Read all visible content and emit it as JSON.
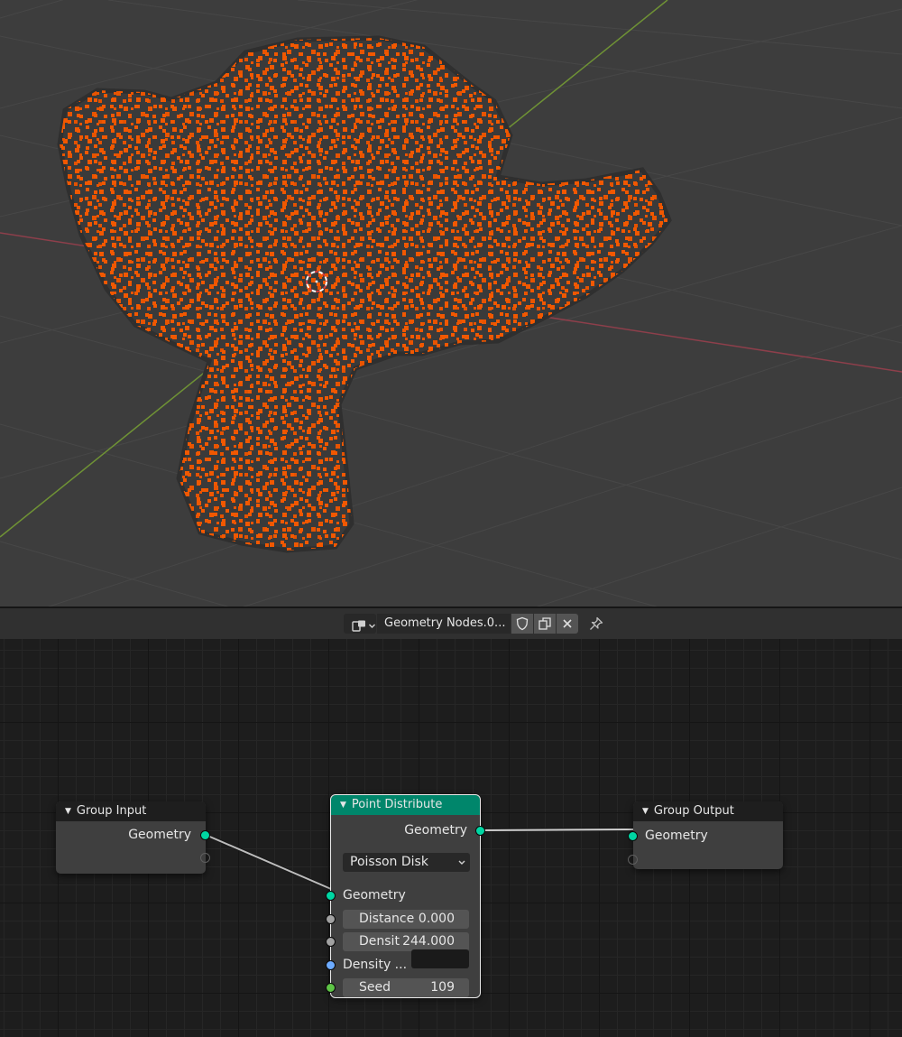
{
  "viewport": {
    "colors": {
      "background": "#3d3d3d",
      "grid": "#484848",
      "x_axis": "#8d3f4b",
      "y_axis": "#6f9235",
      "points": "#f15800",
      "mesh": "#2f2f2f"
    }
  },
  "header": {
    "tree_type_icon": "node-tree-icon",
    "datablock_name": "Geometry Nodes.0...",
    "fake_user_icon": "shield-icon",
    "duplicate_icon": "duplicate-icon",
    "unlink_icon": "close-icon",
    "pin_icon": "pin-icon"
  },
  "nodes": {
    "group_input": {
      "title": "Group Input",
      "outputs": [
        "Geometry"
      ]
    },
    "point_distribute": {
      "title": "Point Distribute",
      "header_color": "#00866b",
      "output_geometry": "Geometry",
      "mode": "Poisson Disk",
      "input_geometry": "Geometry",
      "distance_label": "Distance",
      "distance_value": "0.000",
      "density_label": "Densit",
      "density_value": "244.000",
      "density_attribute_label": "Density ...",
      "density_attribute_value": "",
      "seed_label": "Seed",
      "seed_value": "109"
    },
    "group_output": {
      "title": "Group Output",
      "inputs": [
        "Geometry"
      ]
    }
  },
  "socket_colors": {
    "geometry": "#00d6a3",
    "float": "#a1a1a1",
    "string": "#6dabff",
    "integer": "#5ec446"
  }
}
